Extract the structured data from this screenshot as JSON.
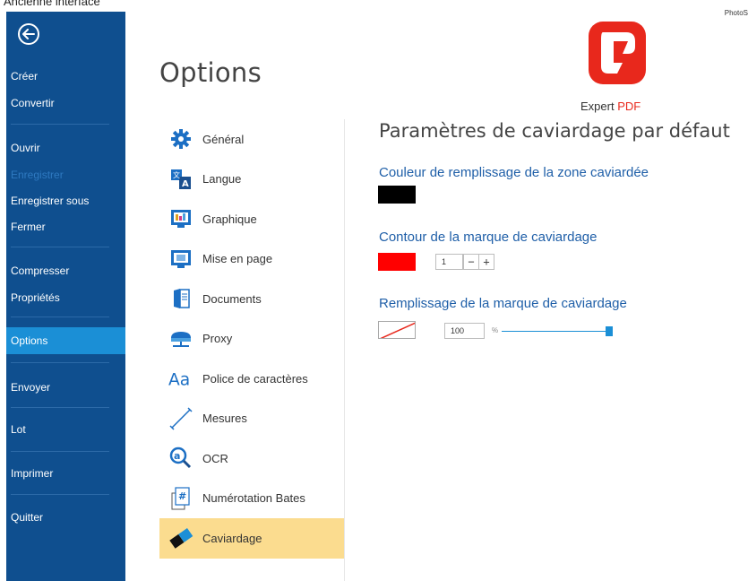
{
  "captions": {
    "top_left": "Ancienne interface",
    "top_right": "PhotoS"
  },
  "sidebar": {
    "items": [
      {
        "label": "Créer"
      },
      {
        "label": "Convertir"
      },
      {
        "label": "Ouvrir"
      },
      {
        "label": "Enregistrer",
        "disabled": true
      },
      {
        "label": "Enregistrer sous"
      },
      {
        "label": "Fermer"
      },
      {
        "label": "Compresser"
      },
      {
        "label": "Propriétés"
      },
      {
        "label": "Options",
        "active": true
      },
      {
        "label": "Envoyer"
      },
      {
        "label": "Lot"
      },
      {
        "label": "Imprimer"
      },
      {
        "label": "Quitter"
      }
    ]
  },
  "page": {
    "title": "Options"
  },
  "logo": {
    "text_plain": "Expert ",
    "text_accent": "PDF",
    "accent_color": "#e8281c"
  },
  "categories": [
    {
      "label": "Général",
      "icon": "gear-icon"
    },
    {
      "label": "Langue",
      "icon": "language-icon"
    },
    {
      "label": "Graphique",
      "icon": "graphics-icon"
    },
    {
      "label": "Mise en page",
      "icon": "layout-icon"
    },
    {
      "label": "Documents",
      "icon": "documents-icon"
    },
    {
      "label": "Proxy",
      "icon": "proxy-icon"
    },
    {
      "label": "Police de caractères",
      "icon": "font-icon"
    },
    {
      "label": "Mesures",
      "icon": "measure-icon"
    },
    {
      "label": "OCR",
      "icon": "ocr-icon"
    },
    {
      "label": "Numérotation Bates",
      "icon": "bates-icon"
    },
    {
      "label": "Caviardage",
      "icon": "eraser-icon",
      "active": true
    }
  ],
  "content": {
    "title": "Paramètres de caviardage par défaut",
    "fill_color": {
      "label": "Couleur de remplissage de la zone caviardée",
      "color": "#000000"
    },
    "outline": {
      "label": "Contour de la marque de caviardage",
      "color": "#ff0000",
      "width_value": "1",
      "minus": "−",
      "plus": "+"
    },
    "mark_fill": {
      "label": "Remplissage de la marque de caviardage",
      "color": "none",
      "opacity_value": "100",
      "unit": "%",
      "slider_fraction": 1.0
    }
  }
}
